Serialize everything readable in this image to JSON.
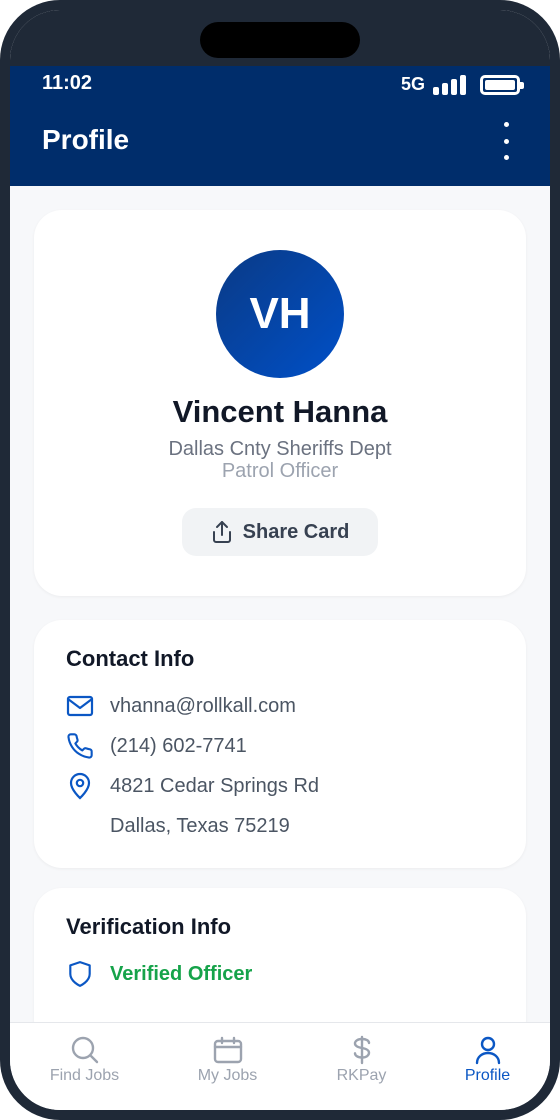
{
  "status_bar": {
    "time": "11:02",
    "network": "5G"
  },
  "header": {
    "title": "Profile"
  },
  "profile": {
    "initials": "VH",
    "name": "Vincent Hanna",
    "department": "Dallas Cnty Sheriffs Dept",
    "rank": "Patrol Officer",
    "share_label": "Share Card"
  },
  "contact": {
    "title": "Contact Info",
    "email": "vhanna@rollkall.com",
    "phone": "(214) 602-7741",
    "address_line1": "4821 Cedar Springs Rd",
    "address_line2": "Dallas, Texas 75219"
  },
  "verification": {
    "title": "Verification Info",
    "status": "Verified Officer"
  },
  "tabs": [
    {
      "label": "Find Jobs",
      "icon": "search-icon"
    },
    {
      "label": "My Jobs",
      "icon": "calendar-icon"
    },
    {
      "label": "RKPay",
      "icon": "dollar-icon"
    },
    {
      "label": "Profile",
      "icon": "user-icon",
      "active": true
    }
  ],
  "colors": {
    "header_bg": "#002d6b",
    "accent": "#0b57c4",
    "verified": "#16a34a"
  }
}
